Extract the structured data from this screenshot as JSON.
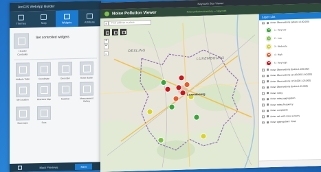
{
  "builder": {
    "app_title": "ArcGIS WebApp Builder",
    "tabs": [
      {
        "label": "Themes",
        "icon": "palette-icon"
      },
      {
        "label": "Map",
        "icon": "map-icon"
      },
      {
        "label": "Widgets",
        "icon": "widgets-icon"
      },
      {
        "label": "Attribute",
        "icon": "attribute-icon"
      }
    ],
    "set_controlled": "Set controlled widgets",
    "header_controller": "Header Controller",
    "widgets": [
      {
        "label": "Attribute Table",
        "icon": "table-icon"
      },
      {
        "label": "Coordinate",
        "icon": "coordinate-icon"
      },
      {
        "label": "Geocoder",
        "icon": "geocoder-icon"
      },
      {
        "label": "Home Button",
        "icon": "home-icon"
      },
      {
        "label": "My Location",
        "icon": "location-icon"
      },
      {
        "label": "Overview Map",
        "icon": "overview-icon"
      },
      {
        "label": "Scalebar",
        "icon": "scalebar-icon"
      },
      {
        "label": "Measurement Gallery",
        "icon": "measure-icon"
      },
      {
        "label": "Basemaps",
        "icon": "basemap-icon"
      },
      {
        "label": "Data",
        "icon": "data-icon"
      }
    ],
    "footer": {
      "preview": "Mock Previews",
      "save": "Save"
    }
  },
  "app": {
    "top_bar": "Nayrooth Star Viewer",
    "title": "Noise Pollution Viewer",
    "subtitle": "Noise pollution inventory — Nayrooth",
    "search_placeholder": "Find address or place",
    "map_labels": {
      "region_main": "LUXEMBOURG",
      "region_nw": "OESLING",
      "city_main": "Luxembourg"
    }
  },
  "layer_list": {
    "title": "Layer List",
    "top_layer": "Noise Observations (above 1:100,000)",
    "symbols": [
      {
        "label": "1 - Very low",
        "color": "#3aa53a"
      },
      {
        "label": "2 - Low",
        "color": "#7bc043"
      },
      {
        "label": "3 - Moderate",
        "color": "#d8d326"
      },
      {
        "label": "4 - High",
        "color": "#e85c2c"
      },
      {
        "label": "5 - Very high",
        "color": "#c8171d"
      }
    ],
    "other_layers": [
      "Noise Observations (below 1:100,000)",
      "Noise Observations (1:100,000-1:50,000)",
      "Noise Observations (1:50,000-1:25,000)",
      "Noise Observations (below 1:25,000)",
      "Noise rating",
      "Noise rating aggregation",
      "Noise rating frequency",
      "Noise complaints",
      "Noise risk with noise sensors",
      "Noise aggregation / Final"
    ]
  },
  "colors": {
    "accent": "#1a7bd1",
    "header_green": "#2f4a3a",
    "builder_dark": "#1e3a4f"
  }
}
